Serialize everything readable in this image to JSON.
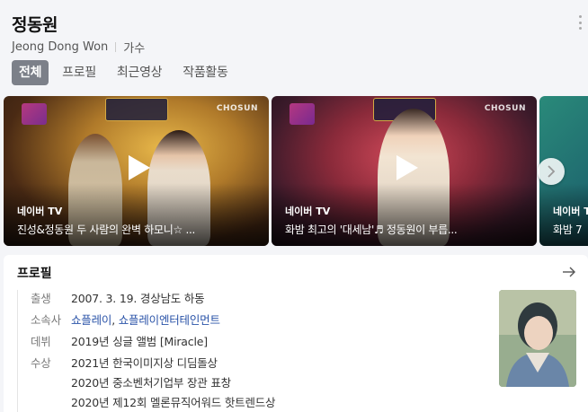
{
  "header": {
    "name": "정동원",
    "romanized": "Jeong Dong Won",
    "occupation": "가수"
  },
  "tabs": [
    {
      "label": "전체",
      "active": true
    },
    {
      "label": "프로필",
      "active": false
    },
    {
      "label": "최근영상",
      "active": false
    },
    {
      "label": "작품활동",
      "active": false
    }
  ],
  "videos": [
    {
      "provider": "네이버 TV",
      "title": "진성&정동원 두 사람의 완벽 하모니☆ ...",
      "overlay_logo": "CHOSUN"
    },
    {
      "provider": "네이버 TV",
      "title": "화밤 최고의 '대세남'♬ 정동원이 부릅...",
      "overlay_logo": "CHOSUN"
    },
    {
      "provider": "네이버 T",
      "title": "화밤 7",
      "overlay_logo": ""
    }
  ],
  "profile": {
    "title": "프로필",
    "rows": [
      {
        "key": "출생",
        "value": "2007. 3. 19. 경상남도 하동"
      },
      {
        "key": "소속사",
        "links": [
          "쇼플레이",
          "쇼플레이엔터테인먼트"
        ]
      },
      {
        "key": "데뷔",
        "value": "2019년 싱글 앨범 [Miracle]"
      },
      {
        "key": "수상",
        "values": [
          "2021년 한국이미지상 디딤돌상",
          "2020년 중소벤처기업부 장관 표창",
          "2020년 제12회 멜론뮤직어워드 핫트렌드상"
        ]
      }
    ]
  },
  "colors": {
    "active_tab_bg": "#7c8089",
    "link": "#2a53a8",
    "page_bg": "#f4f5f8"
  }
}
